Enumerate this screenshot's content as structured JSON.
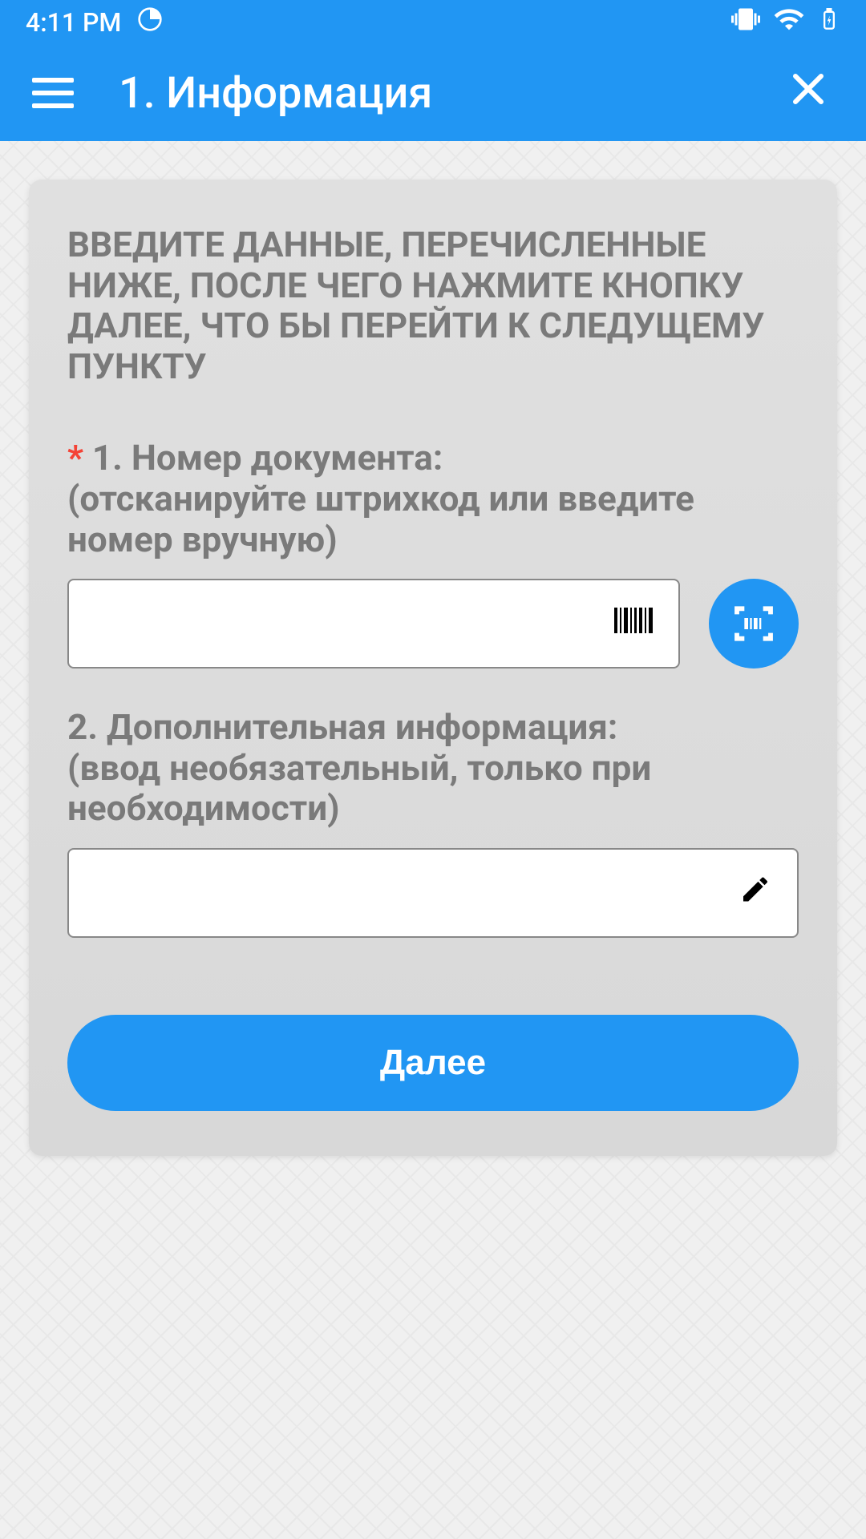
{
  "status_bar": {
    "time": "4:11 PM"
  },
  "app_bar": {
    "title": "1. Информация"
  },
  "card": {
    "instruction": "ВВЕДИТЕ ДАННЫЕ, ПЕРЕЧИСЛЕННЫЕ НИЖЕ, ПОСЛЕ ЧЕГО НАЖМИТЕ КНОПКУ ДАЛЕЕ, ЧТО БЫ ПЕРЕЙТИ К СЛЕДУЩЕМУ ПУНКТУ",
    "field1": {
      "label_line1": "1. Номер документа:",
      "label_line2": "(отсканируйте штрихкод или введите номер вручную)",
      "value": ""
    },
    "field2": {
      "label_line1": "2. Дополнительная информация:",
      "label_line2": "(ввод необязательный, только при необходимости)",
      "value": ""
    },
    "next_button_label": "Далее"
  },
  "colors": {
    "primary": "#2196f3",
    "text_muted": "#7a7a7a",
    "required": "#f44336"
  }
}
